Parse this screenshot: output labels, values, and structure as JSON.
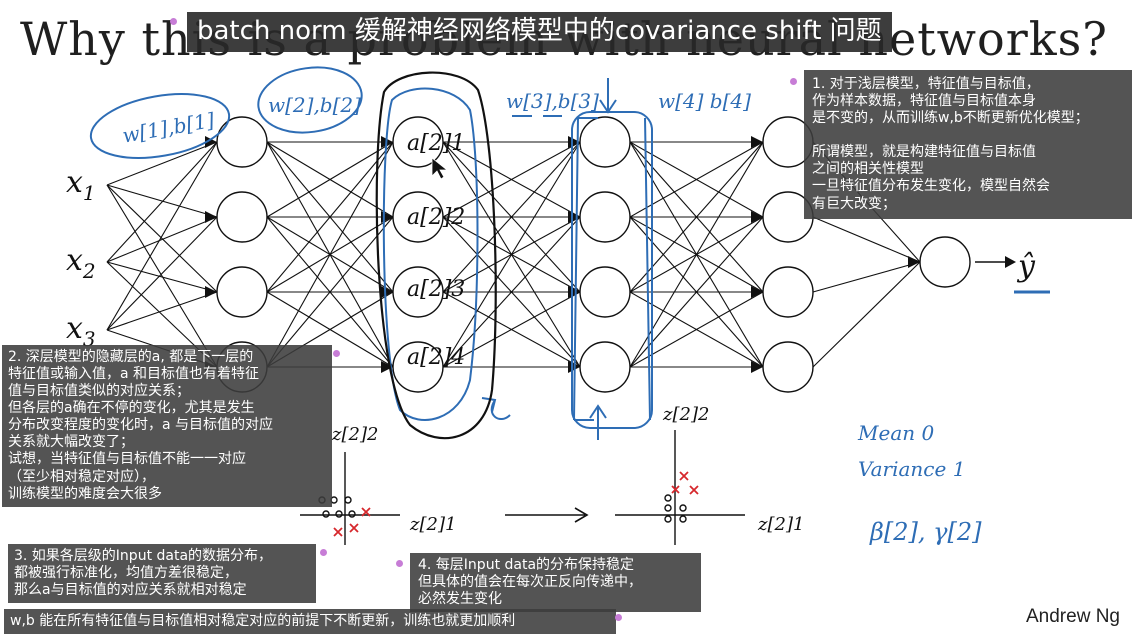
{
  "slide": {
    "title": "Why this is a problem with neural networks?",
    "author": "Andrew Ng",
    "inputs": [
      "x",
      "x",
      "x"
    ],
    "input_subscripts": [
      "1",
      "2",
      "3"
    ],
    "output": "ŷ"
  },
  "captions": {
    "top": "batch norm 缓解神经网络模型中的covariance shift 问题",
    "note1": "1. 对于浅层模型，特征值与目标值，\n作为样本数据，特征值与目标值本身\n是不变的，从而训练w,b不断更新优化模型；\n\n所谓模型，就是构建特征值与目标值\n之间的相关性模型\n一旦特征值分布发生变化，模型自然会\n有巨大改变；",
    "note2": "2. 深层模型的隐藏层的a, 都是下一层的\n特征值或输入值，a 和目标值也有着特征\n值与目标值类似的对应关系；\n但各层的a确在不停的变化，尤其是发生\n分布改变程度的变化时，a 与目标值的对应\n关系就大幅改变了；\n试想，当特征值与目标值不能一一对应\n（至少相对稳定对应），\n训练模型的难度会大很多",
    "note3": "3. 如果各层级的Input data的数据分布，\n都被强行标准化，均值方差很稳定，\n那么a与目标值的对应关系就相对稳定",
    "note4": "4. 每层Input data的分布保持稳定\n但具体的值会在每次正反向传递中，\n必然发生变化",
    "note5": "w,b 能在所有特征值与目标值相对稳定对应的前提下不断更新，训练也就更加顺利"
  },
  "handwriting": {
    "w1b1": "w[1],b[1]",
    "w2b2": "w[2],b[2]",
    "w3b3": "w[3],b[3]",
    "w4b4": "w[4] b[4]",
    "hidden_a": [
      "a[2]1",
      "a[2]2",
      "a[2]3",
      "a[2]4"
    ],
    "z2_label": "z[2]2",
    "z1_axis": "z[2]1",
    "z2_label_right": "z[2]2",
    "z1_axis_right": "z[2]1",
    "mean": "Mean 0",
    "variance": "Variance 1",
    "beta_gamma": "β[2], γ[2]"
  },
  "colors": {
    "ink_blue": "#2e6db5",
    "ink_black": "#151515",
    "caption_bg": "#3c3c3c",
    "dot": "#c77dd6",
    "cross_red": "#d6282c"
  }
}
